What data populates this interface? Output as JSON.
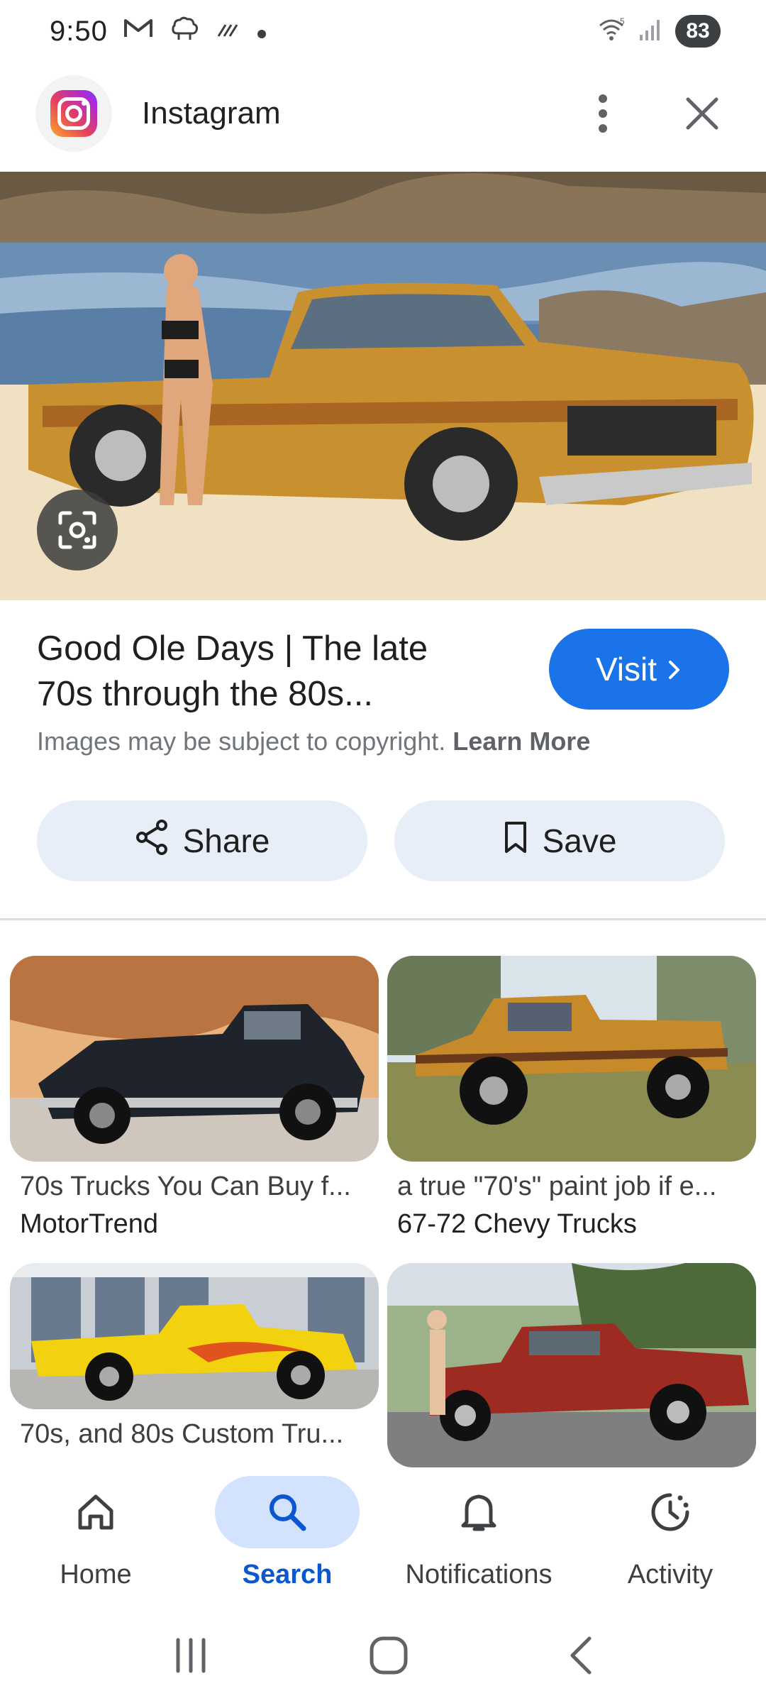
{
  "status_bar": {
    "time": "9:50",
    "notification_icons": [
      "gmail-icon",
      "sheep-icon",
      "missed-call-icon",
      "dot-icon"
    ],
    "battery": "83",
    "wifi_label": "5"
  },
  "header": {
    "site_name": "Instagram",
    "logo_icon": "instagram-logo",
    "more_icon": "more-vert-icon",
    "close_icon": "close-icon"
  },
  "result": {
    "title": "Good Ole Days | The late 70s through the 80s...",
    "visit_label": "Visit",
    "copyright_text": "Images may be subject to copyright.",
    "learn_more": "Learn More",
    "share_label": "Share",
    "save_label": "Save",
    "visit_color": "#1a73e8"
  },
  "related": [
    {
      "title": "70s Trucks You Can Buy f...",
      "source": "MotorTrend"
    },
    {
      "title": "a true \"70's\" paint job if e...",
      "source": "67-72 Chevy Trucks"
    },
    {
      "title": "70s, and 80s Custom Tru...",
      "source": ""
    },
    {
      "title": "",
      "source": ""
    }
  ],
  "bottom_nav": [
    {
      "label": "Home",
      "icon": "home-icon"
    },
    {
      "label": "Search",
      "icon": "search-icon",
      "active": true
    },
    {
      "label": "Notifications",
      "icon": "bell-icon"
    },
    {
      "label": "Activity",
      "icon": "activity-icon"
    }
  ],
  "colors": {
    "active_nav_bg": "#d3e3fd",
    "active_nav_text": "#0b57d0",
    "action_btn_bg": "#e8eef8"
  }
}
